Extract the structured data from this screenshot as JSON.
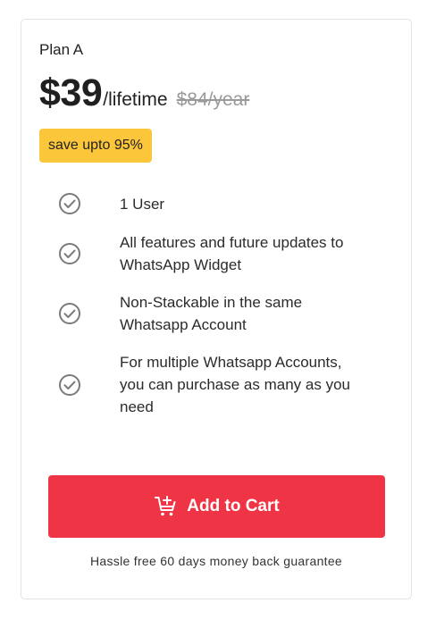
{
  "plan": {
    "name": "Plan A",
    "price": "$39",
    "period": "/lifetime",
    "old_price": "$84/year",
    "save_badge": "save upto 95%"
  },
  "features": [
    {
      "text": "1 User",
      "icon": "check-circle-icon"
    },
    {
      "text": "All features and future updates to WhatsApp Widget",
      "icon": "check-circle-icon"
    },
    {
      "text": "Non-Stackable in the same Whatsapp Account",
      "icon": "check-circle-icon"
    },
    {
      "text": "For multiple Whatsapp Accounts, you can purchase as many as you need",
      "icon": "check-circle-icon"
    }
  ],
  "cart_button": {
    "label": "Add to Cart",
    "icon": "add-to-cart-icon"
  },
  "guarantee": "Hassle free 60 days money back guarantee",
  "colors": {
    "badge": "#fbc63a",
    "button": "#ef3545",
    "check": "#7a7a7a"
  }
}
